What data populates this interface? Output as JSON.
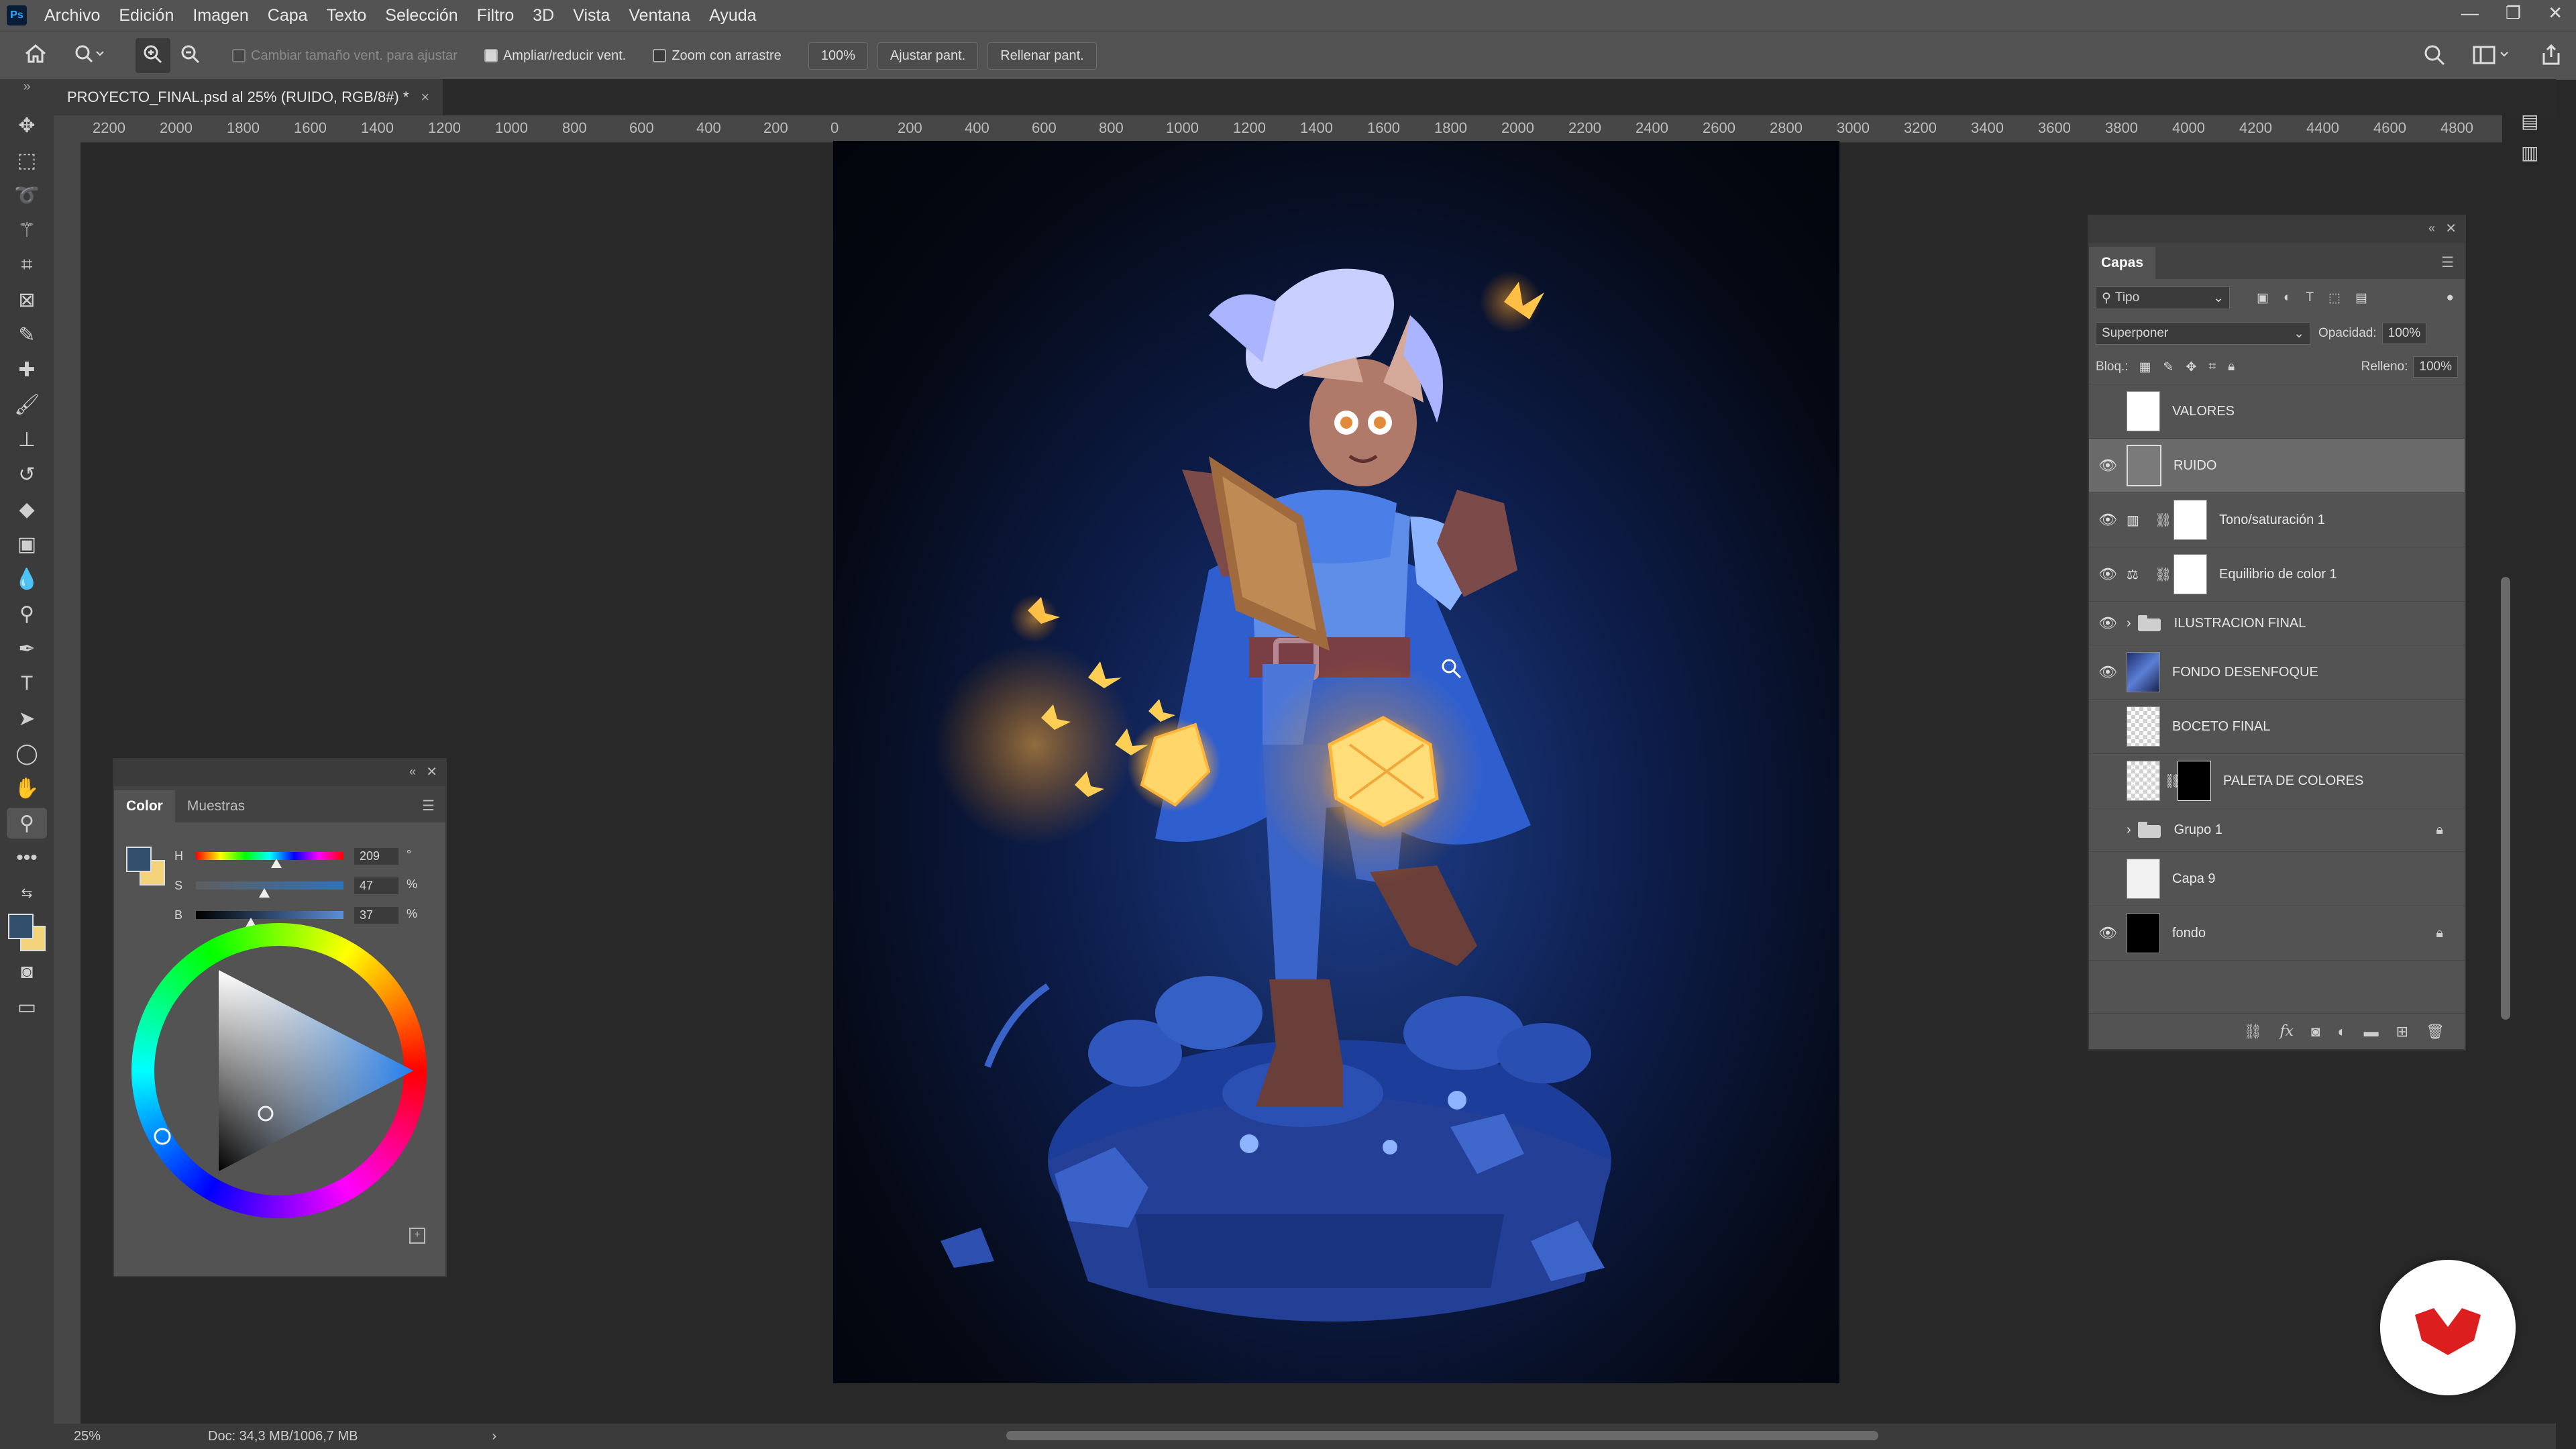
{
  "app": {
    "logo": "Ps"
  },
  "menu": [
    "Archivo",
    "Edición",
    "Imagen",
    "Capa",
    "Texto",
    "Selección",
    "Filtro",
    "3D",
    "Vista",
    "Ventana",
    "Ayuda"
  ],
  "window_controls": [
    "—",
    "❐",
    "✕"
  ],
  "options": {
    "resize_windows": "Cambiar tamaño vent. para ajustar",
    "zoom_resize": "Ampliar/reducir vent.",
    "scrubby_zoom": "Zoom con arrastre",
    "zoom_value": "100%",
    "fit_screen": "Ajustar pant.",
    "fill_screen": "Rellenar pant."
  },
  "document_tab": {
    "title": "PROYECTO_FINAL.psd al 25% (RUIDO, RGB/8#) *",
    "close": "×"
  },
  "ruler_labels": [
    "2200",
    "2000",
    "1800",
    "1600",
    "1400",
    "1200",
    "1000",
    "800",
    "600",
    "400",
    "200",
    "0",
    "200",
    "400",
    "600",
    "800",
    "1000",
    "1200",
    "1400",
    "1600",
    "1800",
    "2000",
    "2200",
    "2400",
    "2600",
    "2800",
    "3000",
    "3200",
    "3400",
    "3600",
    "3800",
    "4000",
    "4200",
    "4400",
    "4600",
    "4800"
  ],
  "color_panel": {
    "tabs": [
      "Color",
      "Muestras"
    ],
    "sliders": [
      {
        "label": "H",
        "value": "209",
        "unit": "°"
      },
      {
        "label": "S",
        "value": "47",
        "unit": "%"
      },
      {
        "label": "B",
        "value": "37",
        "unit": "%"
      }
    ],
    "foreground": "#324f6e",
    "background": "#f3d37a"
  },
  "layers_panel": {
    "title": "Capas",
    "filter_label": "Tipo",
    "blend_mode": "Superponer",
    "opacity_label": "Opacidad:",
    "opacity_value": "100%",
    "lock_label": "Bloq.:",
    "fill_label": "Relleno:",
    "fill_value": "100%",
    "layers": [
      {
        "name": "VALORES",
        "visible": false,
        "selected": false
      },
      {
        "name": "RUIDO",
        "visible": true,
        "selected": true
      },
      {
        "name": "Tono/saturación 1",
        "visible": true,
        "selected": false
      },
      {
        "name": "Equilibrio de color 1",
        "visible": true,
        "selected": false
      },
      {
        "name": "ILUSTRACION FINAL",
        "visible": true,
        "selected": false
      },
      {
        "name": "FONDO DESENFOQUE",
        "visible": true,
        "selected": false
      },
      {
        "name": "BOCETO FINAL",
        "visible": false,
        "selected": false
      },
      {
        "name": "PALETA DE COLORES",
        "visible": false,
        "selected": false
      },
      {
        "name": "Grupo 1",
        "visible": false,
        "selected": false
      },
      {
        "name": "Capa 9",
        "visible": false,
        "selected": false
      },
      {
        "name": "fondo",
        "visible": true,
        "selected": false
      }
    ]
  },
  "status": {
    "zoom": "25%",
    "doc": "Doc: 34,3 MB/1006,7 MB"
  }
}
